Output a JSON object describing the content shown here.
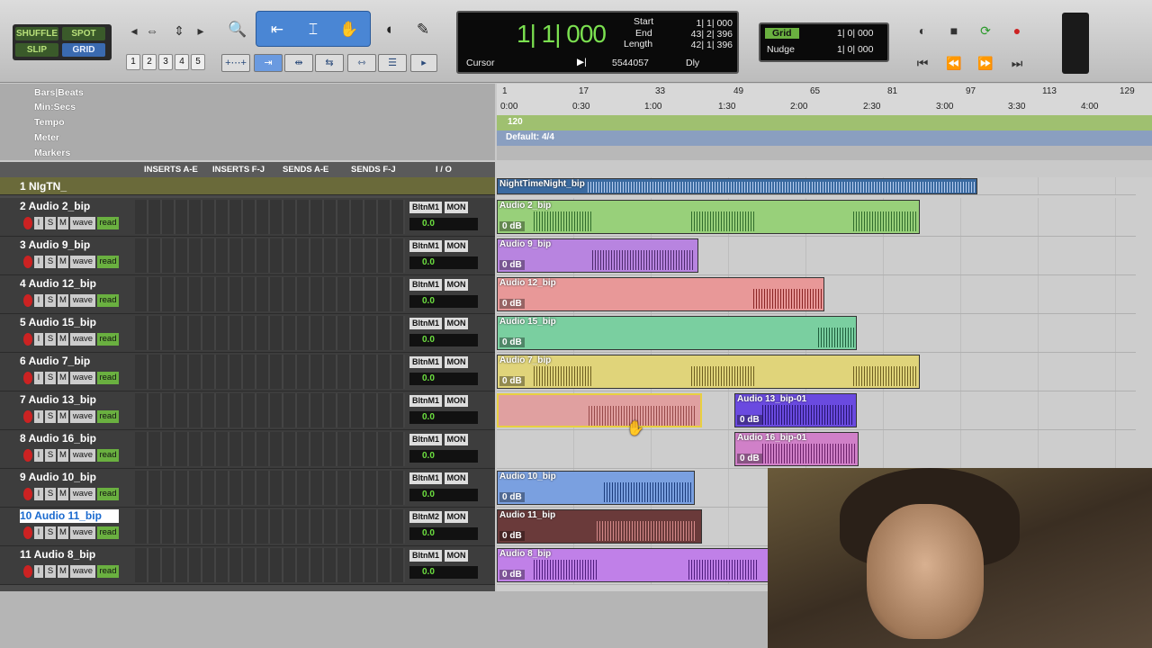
{
  "toolbar": {
    "modes": {
      "shuffle": "SHUFFLE",
      "spot": "SPOT",
      "slip": "SLIP",
      "grid": "GRID"
    },
    "zoom_presets": [
      "1",
      "2",
      "3",
      "4",
      "5"
    ],
    "counter": {
      "main": "1| 1| 000",
      "start_label": "Start",
      "start": "1| 1| 000",
      "end_label": "End",
      "end": "43| 2| 396",
      "length_label": "Length",
      "length": "42| 1| 396",
      "cursor_label": "Cursor",
      "cursor_val": "5544057",
      "dly": "Dly"
    },
    "grid": {
      "label": "Grid",
      "value": "1| 0| 000",
      "nudge_label": "Nudge",
      "nudge_value": "1| 0| 000"
    }
  },
  "rulers": {
    "barsbeats": "Bars|Beats",
    "minsecs": "Min:Secs",
    "tempo": "Tempo",
    "meter": "Meter",
    "markers": "Markers",
    "bar_ticks": [
      "1",
      "17",
      "33",
      "49",
      "65",
      "81",
      "97",
      "113",
      "129"
    ],
    "time_ticks": [
      "0:00",
      "0:30",
      "1:00",
      "1:30",
      "2:00",
      "2:30",
      "3:00",
      "3:30",
      "4:00"
    ],
    "tempo_val": "120",
    "meter_val": "Default: 4/4"
  },
  "columns": {
    "ins_ae": "INSERTS A-E",
    "ins_fj": "INSERTS F-J",
    "sends_ae": "SENDS A-E",
    "sends_fj": "SENDS F-J",
    "io": "I / O"
  },
  "tracks": [
    {
      "name": "1  NIgTN_",
      "io": "",
      "mon": "",
      "vol": ""
    },
    {
      "name": "2  Audio 2_bip",
      "io": "BltnM1",
      "mon": "MON",
      "vol": "0.0"
    },
    {
      "name": "3  Audio 9_bip",
      "io": "BltnM1",
      "mon": "MON",
      "vol": "0.0"
    },
    {
      "name": "4  Audio 12_bip",
      "io": "BltnM1",
      "mon": "MON",
      "vol": "0.0"
    },
    {
      "name": "5  Audio 15_bip",
      "io": "BltnM1",
      "mon": "MON",
      "vol": "0.0"
    },
    {
      "name": "6  Audio 7_bip",
      "io": "BltnM1",
      "mon": "MON",
      "vol": "0.0"
    },
    {
      "name": "7  Audio 13_bip",
      "io": "BltnM1",
      "mon": "MON",
      "vol": "0.0"
    },
    {
      "name": "8  Audio 16_bip",
      "io": "BltnM1",
      "mon": "MON",
      "vol": "0.0"
    },
    {
      "name": "9  Audio 10_bip",
      "io": "BltnM1",
      "mon": "MON",
      "vol": "0.0"
    },
    {
      "name": "10 Audio 11_bip",
      "io": "BltnM2",
      "mon": "MON",
      "vol": "0.0"
    },
    {
      "name": "11  Audio 8_bip",
      "io": "BltnM1",
      "mon": "MON",
      "vol": "0.0"
    }
  ],
  "track_buttons": {
    "i": "I",
    "s": "S",
    "m": "M",
    "wave": "wave",
    "read": "read"
  },
  "clips": [
    {
      "name": "NightTimeNight_bip",
      "gain": ""
    },
    {
      "name": "Audio 2_bip",
      "gain": "0 dB"
    },
    {
      "name": "Audio 9_bip",
      "gain": "0 dB"
    },
    {
      "name": "Audio 12_bip",
      "gain": "0 dB"
    },
    {
      "name": "Audio 15_bip",
      "gain": "0 dB"
    },
    {
      "name": "Audio 7_bip",
      "gain": "0 dB"
    },
    {
      "name": "Audio 13_bip-01",
      "gain": "0 dB"
    },
    {
      "name": "Audio 16_bip-01",
      "gain": "0 dB"
    },
    {
      "name": "Audio 10_bip",
      "gain": "0 dB"
    },
    {
      "name": "Audio 11_bip",
      "gain": "0 dB"
    },
    {
      "name": "Audio 8_bip",
      "gain": "0 dB"
    }
  ],
  "colors": {
    "accent": "#4a86d4",
    "counter_green": "#7be050",
    "read_green": "#6ab040"
  }
}
